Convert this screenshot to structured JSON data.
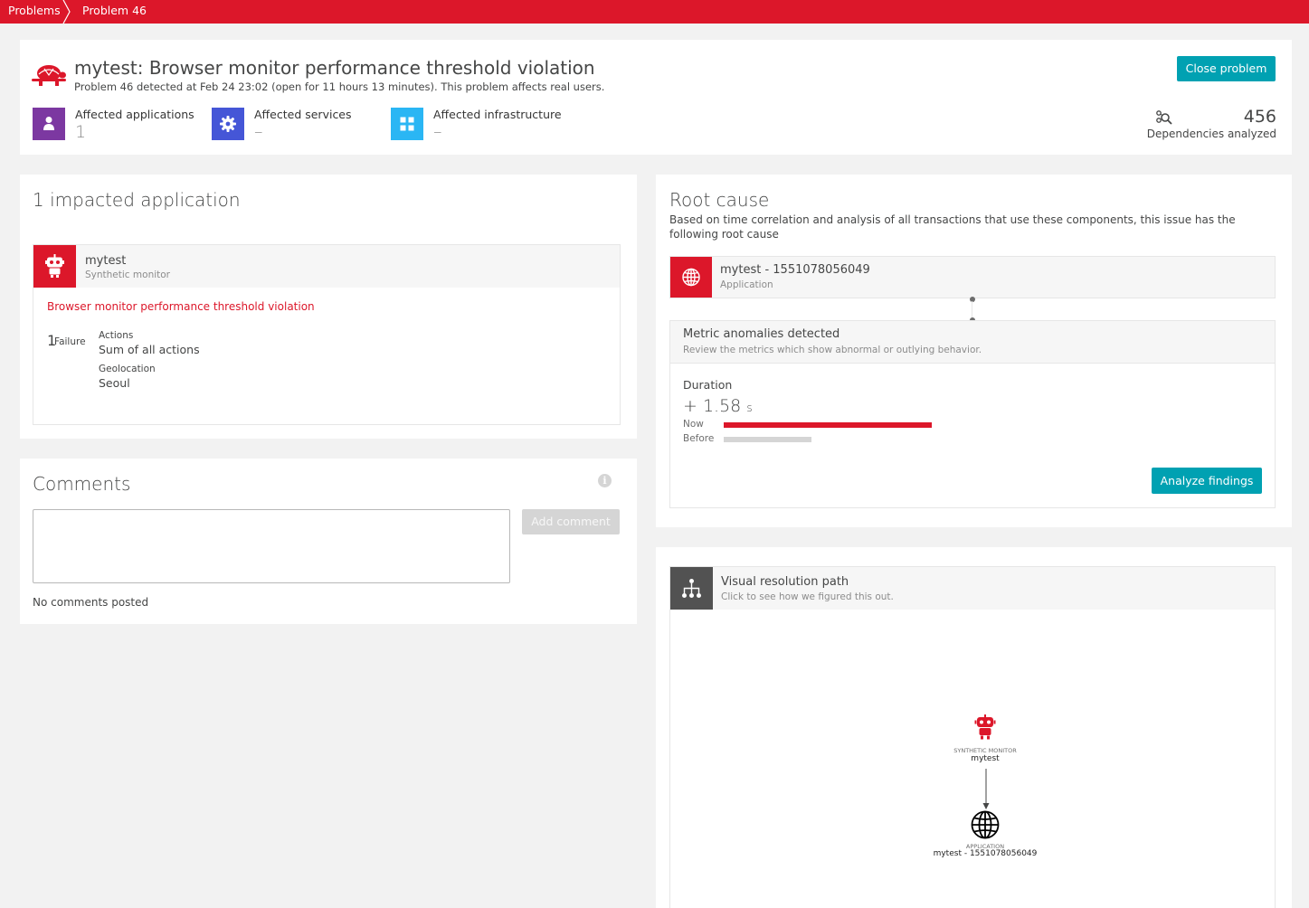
{
  "breadcrumb": {
    "items": [
      "Problems",
      "Problem 46"
    ]
  },
  "problem": {
    "title": "mytest: Browser monitor performance threshold violation",
    "subtitle": "Problem 46 detected at Feb 24 23:02 (open for 11 hours 13 minutes). This problem affects real users.",
    "close_label": "Close problem"
  },
  "affected": [
    {
      "label": "Affected applications",
      "value": "1",
      "icon": "user-icon",
      "color": "#7c38a1"
    },
    {
      "label": "Affected services",
      "value": "–",
      "icon": "gear-icon",
      "color": "#4556d7"
    },
    {
      "label": "Affected infrastructure",
      "value": "–",
      "icon": "infrastructure-icon",
      "color": "#2ab6f4"
    }
  ],
  "dependencies": {
    "count": "456",
    "label": "Dependencies analyzed"
  },
  "impacted": {
    "title": "1 impacted application",
    "entity_name": "mytest",
    "entity_type": "Synthetic monitor",
    "violation": "Browser monitor performance threshold violation",
    "failure_count": "1",
    "failure_label": "Failure",
    "actions_key": "Actions",
    "actions_value": "Sum of all actions",
    "geo_key": "Geolocation",
    "geo_value": "Seoul"
  },
  "comments": {
    "title": "Comments",
    "add_label": "Add comment",
    "empty_text": "No comments posted",
    "value": ""
  },
  "root_cause": {
    "title": "Root cause",
    "description": "Based on time correlation and analysis of all transactions that use these components, this issue has the following root cause",
    "entity_name": "mytest - 1551078056049",
    "entity_type": "Application",
    "anomalies_title": "Metric anomalies detected",
    "anomalies_sub": "Review the metrics which show abnormal or outlying behavior.",
    "metric_name": "Duration",
    "metric_delta": "+ 1.58",
    "metric_unit": "s",
    "now_label": "Now",
    "before_label": "Before",
    "now_fraction": 0.64,
    "before_fraction": 0.27,
    "analyze_label": "Analyze findings"
  },
  "resolution_path": {
    "title": "Visual resolution path",
    "subtitle": "Click to see how we figured this out.",
    "node1_type": "SYNTHETIC MONITOR",
    "node1_name": "mytest",
    "node2_type": "APPLICATION",
    "node2_name": "mytest - 1551078056049"
  },
  "colors": {
    "brand_red": "#dc172a",
    "teal": "#00a1b2"
  }
}
